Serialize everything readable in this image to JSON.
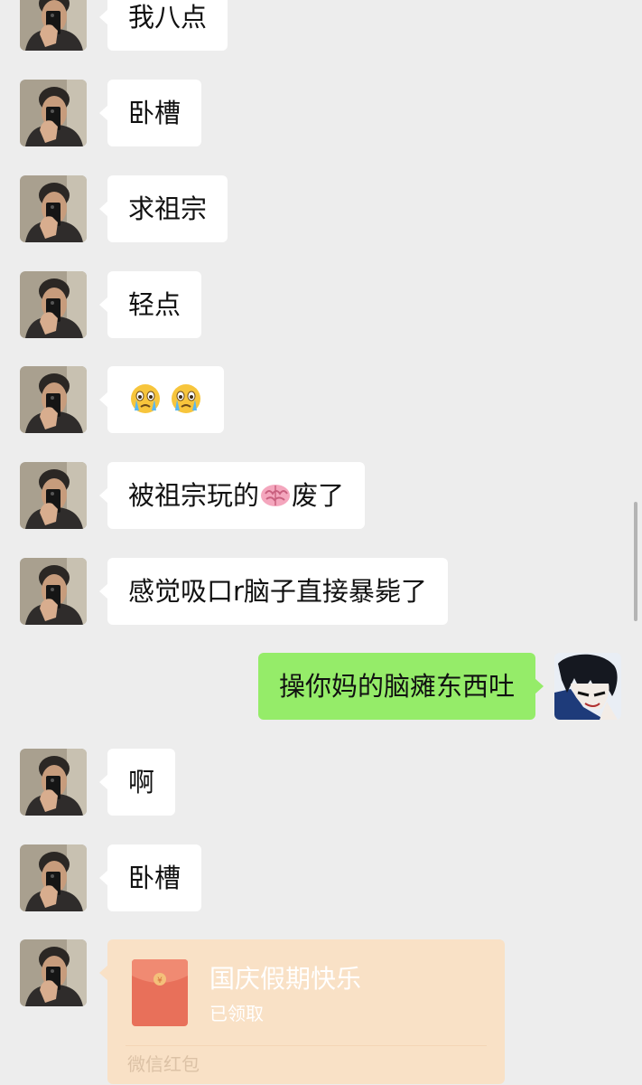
{
  "messages": [
    {
      "side": "in",
      "kind": "text",
      "text": "我八点"
    },
    {
      "side": "in",
      "kind": "text",
      "text": "卧槽"
    },
    {
      "side": "in",
      "kind": "text",
      "text": "求祖宗"
    },
    {
      "side": "in",
      "kind": "text",
      "text": "轻点"
    },
    {
      "side": "in",
      "kind": "emoji",
      "emojis": [
        "crying-face-emoji",
        "crying-face-emoji"
      ]
    },
    {
      "side": "in",
      "kind": "mixed",
      "before": "被祖宗玩的",
      "emoji": "brain-emoji",
      "after": "废了"
    },
    {
      "side": "in",
      "kind": "text",
      "text": "感觉吸口r脑子直接暴毙了"
    },
    {
      "side": "out",
      "kind": "text",
      "text": "操你妈的脑瘫东西吐"
    },
    {
      "side": "in",
      "kind": "text",
      "text": "啊"
    },
    {
      "side": "in",
      "kind": "text",
      "text": "卧槽"
    },
    {
      "side": "in",
      "kind": "red_packet",
      "title": "国庆假期快乐",
      "status": "已领取",
      "footer": "微信红包"
    }
  ],
  "colors": {
    "background": "#ededed",
    "incoming_bubble": "#ffffff",
    "outgoing_bubble": "#95ec69",
    "red_packet_bg": "#f9e1c6",
    "red_packet_icon": "#e8705a"
  }
}
